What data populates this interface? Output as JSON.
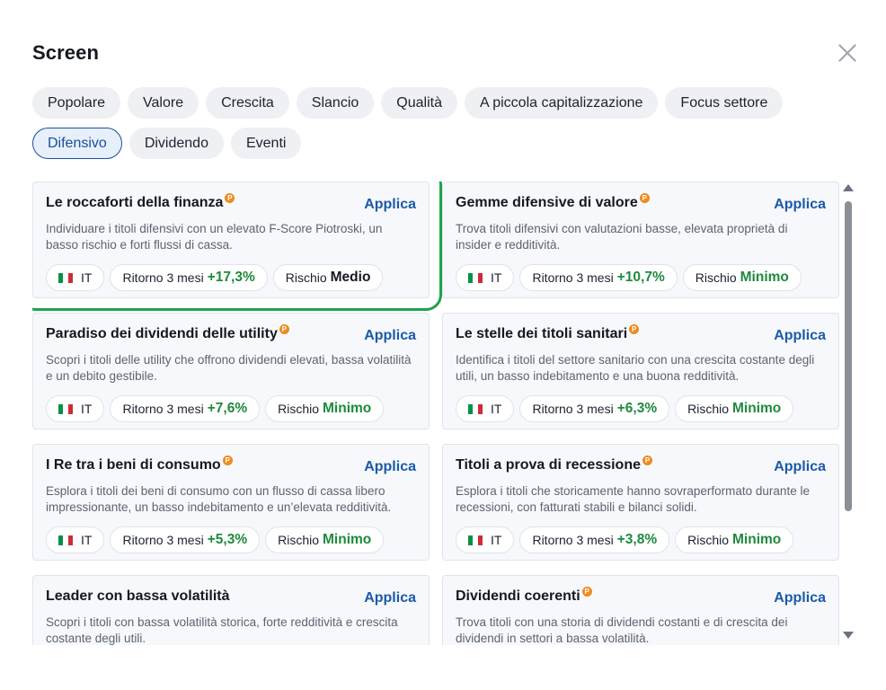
{
  "header": {
    "title": "Screen"
  },
  "categories": [
    [
      {
        "label": "Popolare",
        "active": false
      },
      {
        "label": "Valore",
        "active": false
      },
      {
        "label": "Crescita",
        "active": false
      },
      {
        "label": "Slancio",
        "active": false
      },
      {
        "label": "Qualità",
        "active": false
      },
      {
        "label": "A piccola capitalizzazione",
        "active": false
      },
      {
        "label": "Focus settore",
        "active": false
      }
    ],
    [
      {
        "label": "Difensivo",
        "active": true
      },
      {
        "label": "Dividendo",
        "active": false
      },
      {
        "label": "Eventi",
        "active": false
      }
    ]
  ],
  "labels": {
    "apply": "Applica",
    "return_label": "Ritorno 3 mesi",
    "risk_label": "Rischio"
  },
  "flag_colors": [
    "#009246",
    "#ffffff",
    "#ce2b37"
  ],
  "accent_color": "#1b5aa8",
  "positive_color": "#1e8a3d",
  "highlight_color": "#1ea44b",
  "screens": [
    {
      "title": "Le roccaforti della finanza",
      "pro": true,
      "desc": "Individuare i titoli difensivi con un elevato F-Score Piotroski, un basso rischio e forti flussi di cassa.",
      "market": "IT",
      "return": "+17,3%",
      "risk": "Medio",
      "highlighted": true
    },
    {
      "title": "Gemme difensive di valore",
      "pro": true,
      "desc": "Trova titoli difensivi con valutazioni basse, elevata proprietà di insider e redditività.",
      "market": "IT",
      "return": "+10,7%",
      "risk": "Minimo",
      "highlighted": false
    },
    {
      "title": "Paradiso dei dividendi delle utility",
      "pro": true,
      "desc": "Scopri i titoli delle utility che offrono dividendi elevati, bassa volatilità e un debito gestibile.",
      "market": "IT",
      "return": "+7,6%",
      "risk": "Minimo",
      "highlighted": false
    },
    {
      "title": "Le stelle dei titoli sanitari",
      "pro": true,
      "desc": "Identifica i titoli del settore sanitario con una crescita costante degli utili, un basso indebitamento e una buona redditività.",
      "market": "IT",
      "return": "+6,3%",
      "risk": "Minimo",
      "highlighted": false
    },
    {
      "title": "I Re tra i beni di consumo",
      "pro": true,
      "desc": "Esplora i titoli dei beni di consumo con un flusso di cassa libero impressionante, un basso indebitamento e un’elevata redditività.",
      "market": "IT",
      "return": "+5,3%",
      "risk": "Minimo",
      "highlighted": false
    },
    {
      "title": "Titoli a prova di recessione",
      "pro": true,
      "desc": "Esplora i titoli che storicamente hanno sovraperformato durante le recessioni, con fatturati stabili e bilanci solidi.",
      "market": "IT",
      "return": "+3,8%",
      "risk": "Minimo",
      "highlighted": false
    },
    {
      "title": "Leader con bassa volatilità",
      "pro": false,
      "desc": "Scopri i titoli con bassa volatilità storica, forte redditività e crescita costante degli utili.",
      "market": "",
      "return": "",
      "risk": "",
      "highlighted": false
    },
    {
      "title": "Dividendi coerenti",
      "pro": true,
      "desc": "Trova titoli con una storia di dividendi costanti e di crescita dei dividendi in settori a bassa volatilità.",
      "market": "",
      "return": "",
      "risk": "",
      "highlighted": false
    }
  ]
}
